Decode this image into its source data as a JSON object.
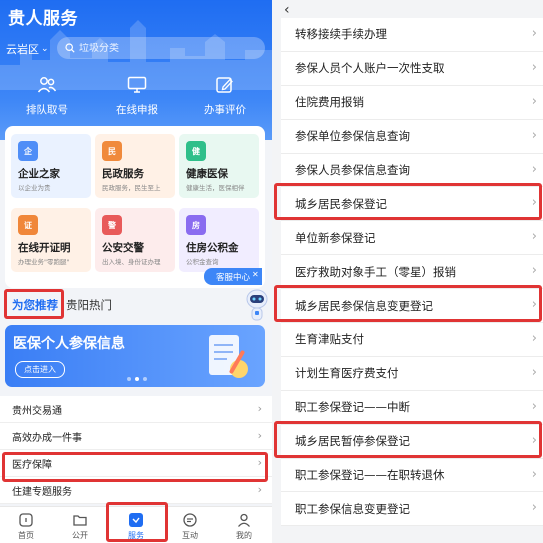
{
  "left": {
    "app_title": "贵人服务",
    "region": "云岩区",
    "search_placeholder": "垃圾分类",
    "quick_actions": [
      {
        "label": "排队取号",
        "icon": "people-icon"
      },
      {
        "label": "在线申报",
        "icon": "monitor-icon"
      },
      {
        "label": "办事评价",
        "icon": "edit-icon"
      }
    ],
    "tiles": [
      {
        "name": "企业之家",
        "sub": "以企业为贵",
        "icon_text": "企",
        "color": "#4f8ef7",
        "bg": "#eaf2ff"
      },
      {
        "name": "民政服务",
        "sub": "民政服务，民生至上",
        "icon_text": "民",
        "color": "#f08a3c",
        "bg": "#fff1e6"
      },
      {
        "name": "健康医保",
        "sub": "健康生活，医保相伴",
        "icon_text": "健",
        "color": "#2fbf8a",
        "bg": "#e8f8f1"
      },
      {
        "name": "在线开证明",
        "sub": "办理业务\"零跑腿\"",
        "icon_text": "证",
        "color": "#f0873a",
        "bg": "#fff1e6"
      },
      {
        "name": "公安交警",
        "sub": "出入境、身份证办理",
        "icon_text": "警",
        "color": "#e85a5a",
        "bg": "#fdecec"
      },
      {
        "name": "住房公积金",
        "sub": "公积金查询",
        "icon_text": "房",
        "color": "#8a6cf0",
        "bg": "#f1edff"
      }
    ],
    "service_pill": "客服中心",
    "tabs": {
      "recommended": "为您推荐",
      "hot": "贵阳热门"
    },
    "banner": {
      "title": "医保个人参保信息",
      "button": "点击进入"
    },
    "list": [
      "贵州交易通",
      "高效办成一件事",
      "医疗保障",
      "住建专题服务"
    ],
    "nav": [
      {
        "label": "首页",
        "icon": "home-icon"
      },
      {
        "label": "公开",
        "icon": "folder-icon"
      },
      {
        "label": "服务",
        "icon": "service-shield-icon"
      },
      {
        "label": "互动",
        "icon": "chat-icon"
      },
      {
        "label": "我的",
        "icon": "user-icon"
      }
    ],
    "accent": "#1f6df2",
    "highlight": "#e03434"
  },
  "right": {
    "back_icon": "back-arrow-icon",
    "items": [
      "转移接续手续办理",
      "参保人员个人账户一次性支取",
      "住院费用报销",
      "参保单位参保信息查询",
      "参保人员参保信息查询",
      "城乡居民参保登记",
      "单位新参保登记",
      "医疗救助对象手工（零星）报销",
      "城乡居民参保信息变更登记",
      "生育津贴支付",
      "计划生育医疗费支付",
      "职工参保登记——中断",
      "城乡居民暂停参保登记",
      "职工参保登记——在职转退休",
      "职工参保信息变更登记"
    ]
  }
}
